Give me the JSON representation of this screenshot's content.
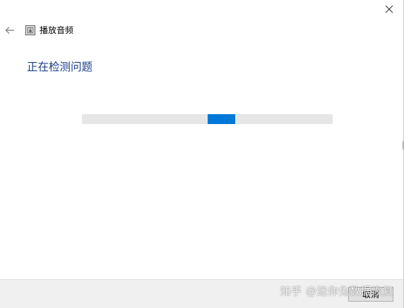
{
  "window": {
    "title": "播放音频",
    "close_icon": "close-icon",
    "back_icon": "back-arrow-icon",
    "app_icon": "speaker-troubleshooter-icon"
  },
  "main": {
    "heading": "正在检测问题",
    "progress": {
      "state": "indeterminate",
      "segment_start_fraction": 0.5,
      "segment_length_fraction": 0.11,
      "track_color": "#e6e6e6",
      "fill_color": "#0078d7"
    }
  },
  "footer": {
    "cancel_label": "取消"
  },
  "watermark": {
    "text": "知乎 @迷你兔数据恢复"
  },
  "colors": {
    "heading": "#1e3f8a",
    "accent": "#0078d7",
    "footer_bg": "#f0f0f0"
  }
}
